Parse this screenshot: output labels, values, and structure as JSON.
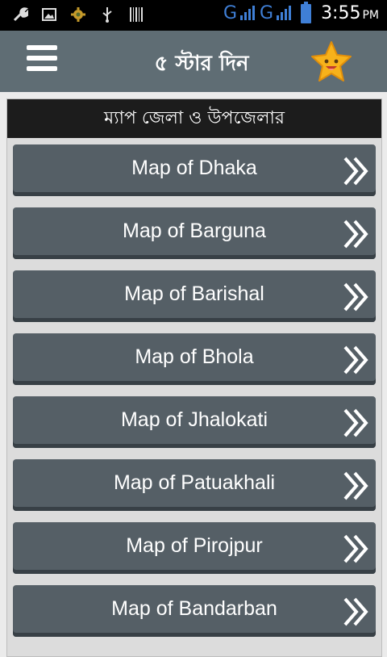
{
  "status_bar": {
    "time": "3:55",
    "ampm": "PM",
    "network_1": "G",
    "network_2": "G",
    "icons": [
      "wrench-icon",
      "image-icon",
      "settings-icon",
      "usb-icon",
      "barcode-icon",
      "signal-icon",
      "battery-icon"
    ]
  },
  "app_bar": {
    "title": "৫ স্টার দিন",
    "menu_icon": "hamburger-menu-icon",
    "rate_icon": "smiling-star-icon"
  },
  "section": {
    "title": "ম্যাপ জেলা ও উপজেলার"
  },
  "maps": [
    {
      "label": "Map of Dhaka"
    },
    {
      "label": "Map of Barguna"
    },
    {
      "label": "Map of Barishal"
    },
    {
      "label": "Map of Bhola"
    },
    {
      "label": "Map of Jhalokati"
    },
    {
      "label": "Map of Patuakhali"
    },
    {
      "label": "Map of Pirojpur"
    },
    {
      "label": "Map of Bandarban"
    }
  ],
  "colors": {
    "app_bar": "#5f6d74",
    "item_bg": "#555f66",
    "section_bg": "#1c1c1c",
    "status_accent": "#3f7fd6",
    "star": "#f7b21b"
  }
}
